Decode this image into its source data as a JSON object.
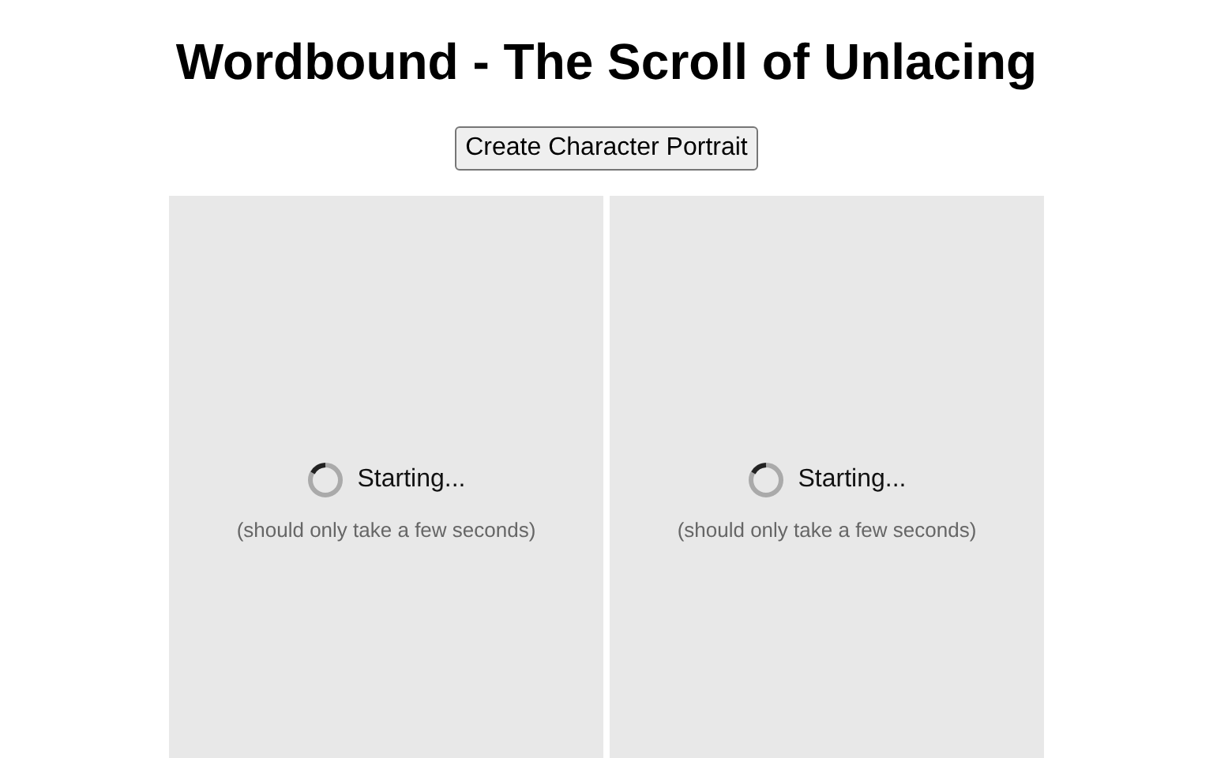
{
  "title": "Wordbound - The Scroll of Unlacing",
  "button": "Create Character Portrait",
  "panels": [
    {
      "status": "Starting...",
      "note": "(should only take a few seconds)"
    },
    {
      "status": "Starting...",
      "note": "(should only take a few seconds)"
    }
  ]
}
